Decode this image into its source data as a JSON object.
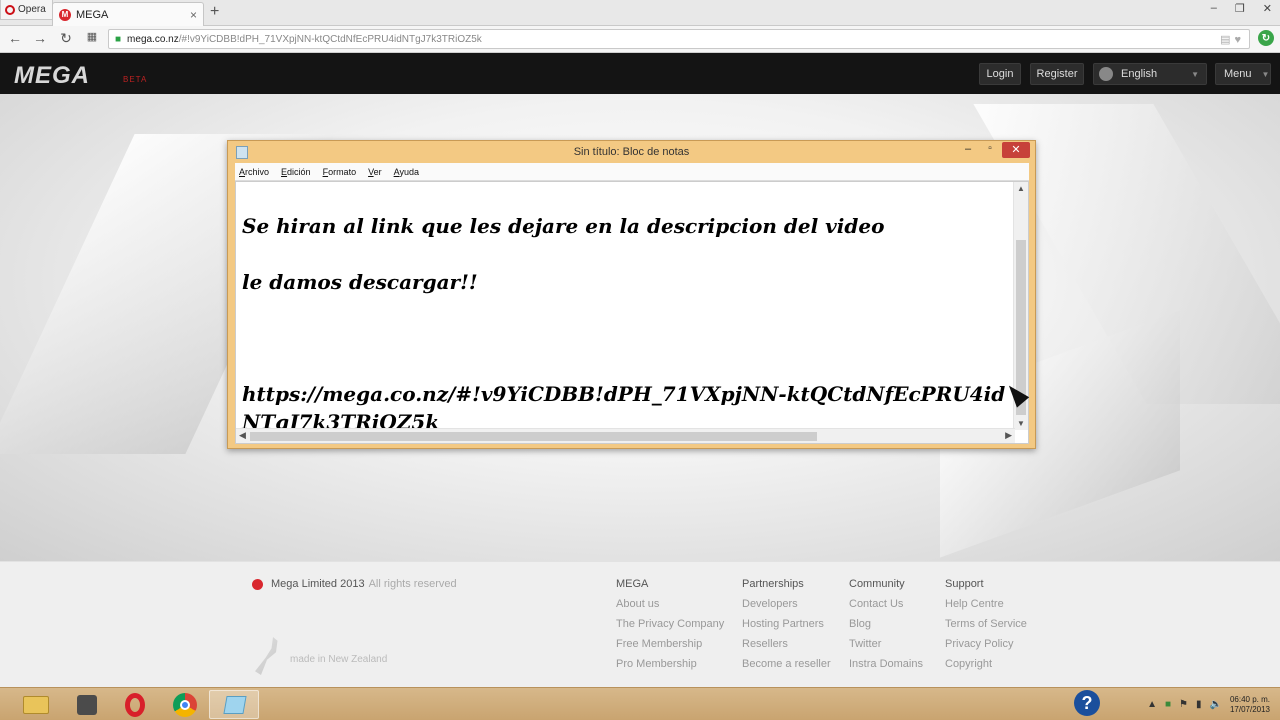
{
  "browser": {
    "opera_label": "Opera",
    "tab_title": "MEGA",
    "url_host": "mega.co.nz",
    "url_path": "/#!v9YiCDBB!dPH_71VXpjNN-ktQCtdNfEcPRU4idNTgJ7k3TRiOZ5k"
  },
  "mega_header": {
    "logo": "MEGA",
    "beta": "BETA",
    "login": "Login",
    "register": "Register",
    "language": "English",
    "menu": "Menu"
  },
  "notepad": {
    "title": "Sin título: Bloc de notas",
    "menus": [
      "Archivo",
      "Edición",
      "Formato",
      "Ver",
      "Ayuda"
    ],
    "content": "Se hiran al link que les dejare en la descripcion del video\n\nle damos descargar!!\n\n\n\nhttps://mega.co.nz/#!v9YiCDBB!dPH_71VXpjNN-ktQCtdNfEcPRU4idNTgJ7k3TRiOZ5k"
  },
  "footer": {
    "copyright": "Mega Limited 2013",
    "rights": "All rights reserved",
    "made_in": "made in New Zealand",
    "columns": [
      {
        "heading": "MEGA",
        "links": [
          "About us",
          "The Privacy Company",
          "Free Membership",
          "Pro Membership"
        ]
      },
      {
        "heading": "Partnerships",
        "links": [
          "Developers",
          "Hosting Partners",
          "Resellers",
          "Become a reseller"
        ]
      },
      {
        "heading": "Community",
        "links": [
          "Contact Us",
          "Blog",
          "Twitter",
          "Instra Domains"
        ]
      },
      {
        "heading": "Support",
        "links": [
          "Help Centre",
          "Terms of Service",
          "Privacy Policy",
          "Copyright"
        ]
      }
    ]
  },
  "taskbar": {
    "time": "06:40 p. m.",
    "date": "17/07/2013"
  },
  "colors": {
    "mega_red": "#d9272e",
    "notepad_frame": "#f3c983",
    "taskbar": "#c9a470"
  }
}
